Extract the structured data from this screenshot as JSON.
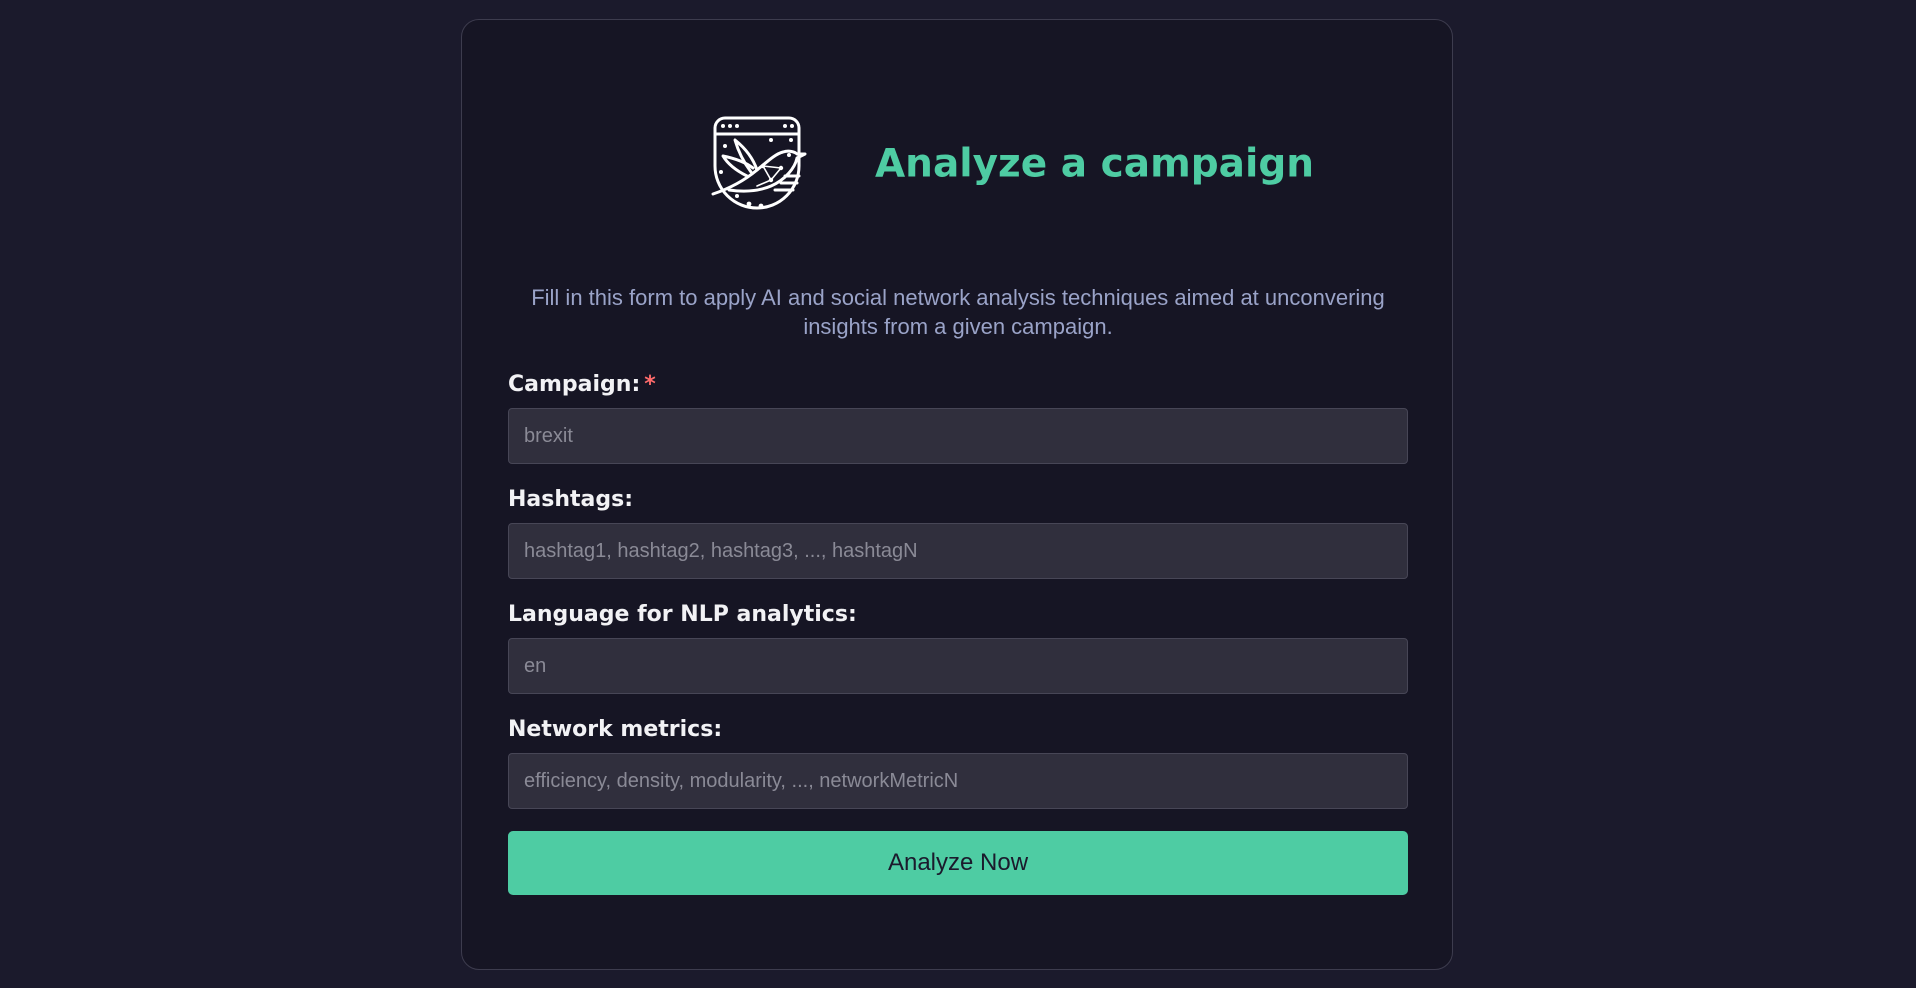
{
  "page": {
    "title": "Analyze a campaign",
    "intro": "Fill in this form to apply AI and social network analysis techniques aimed at unconvering insights from a given campaign.",
    "logo_icon": "hummingbird-network-icon"
  },
  "form": {
    "campaign": {
      "label": "Campaign:",
      "required_mark": "*",
      "placeholder": "brexit",
      "value": ""
    },
    "hashtags": {
      "label": "Hashtags:",
      "placeholder": "hashtag1, hashtag2, hashtag3, ..., hashtagN",
      "value": ""
    },
    "language": {
      "label": "Language for NLP analytics:",
      "placeholder": "en",
      "value": ""
    },
    "metrics": {
      "label": "Network metrics:",
      "placeholder": "efficiency, density, modularity, ..., networkMetricN",
      "value": ""
    },
    "submit_label": "Analyze Now"
  },
  "colors": {
    "background": "#1b1a2c",
    "card": "#161524",
    "accent": "#4ecca3",
    "intro_text": "#9aa3c8",
    "required": "#ff6b6b",
    "input_bg": "#302f3d"
  }
}
